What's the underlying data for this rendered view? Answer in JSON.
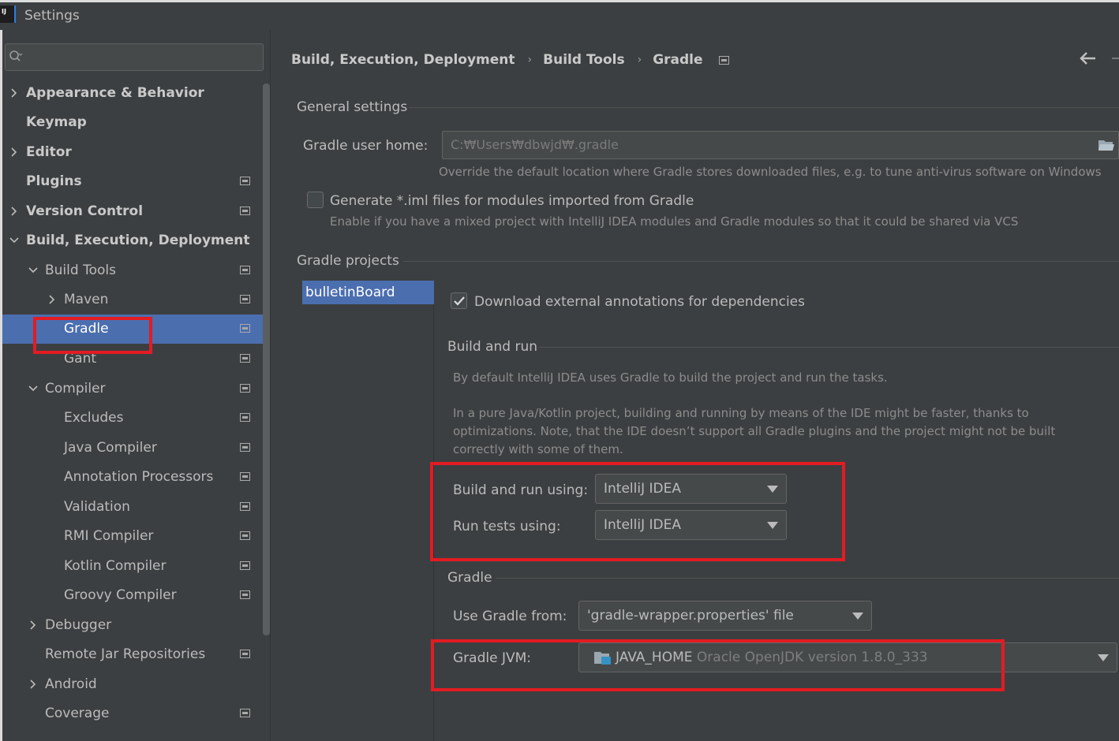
{
  "window": {
    "title": "Settings",
    "logo_text": "IJ"
  },
  "search": {
    "placeholder": "",
    "value": ""
  },
  "sidebar": {
    "items": [
      {
        "label": "Appearance & Behavior",
        "bold": true,
        "chevron": "right"
      },
      {
        "label": "Keymap",
        "bold": true
      },
      {
        "label": "Editor",
        "bold": true,
        "chevron": "right"
      },
      {
        "label": "Plugins",
        "bold": true,
        "project_icon": true
      },
      {
        "label": "Version Control",
        "bold": true,
        "chevron": "right",
        "project_icon": true
      },
      {
        "label": "Build, Execution, Deployment",
        "bold": true,
        "chevron": "down"
      },
      {
        "label": "Build Tools",
        "chevron": "down",
        "project_icon": true
      },
      {
        "label": "Maven",
        "chevron": "right",
        "project_icon": true
      },
      {
        "label": "Gradle",
        "selected": true,
        "project_icon": true
      },
      {
        "label": "Gant",
        "project_icon": true
      },
      {
        "label": "Compiler",
        "chevron": "down",
        "project_icon": true
      },
      {
        "label": "Excludes",
        "project_icon": true
      },
      {
        "label": "Java Compiler",
        "project_icon": true
      },
      {
        "label": "Annotation Processors",
        "project_icon": true
      },
      {
        "label": "Validation",
        "project_icon": true
      },
      {
        "label": "RMI Compiler",
        "project_icon": true
      },
      {
        "label": "Kotlin Compiler",
        "project_icon": true
      },
      {
        "label": "Groovy Compiler",
        "project_icon": true
      },
      {
        "label": "Debugger",
        "chevron": "right"
      },
      {
        "label": "Remote Jar Repositories",
        "project_icon": true
      },
      {
        "label": "Android",
        "chevron": "right"
      },
      {
        "label": "Coverage",
        "project_icon": true
      }
    ]
  },
  "breadcrumb": {
    "items": [
      "Build, Execution, Deployment",
      "Build Tools",
      "Gradle"
    ],
    "separator": "›"
  },
  "general": {
    "title": "General settings",
    "user_home_label": "Gradle user home:",
    "user_home_value": "C:₩Users₩dbwjd₩.gradle",
    "user_home_hint": "Override the default location where Gradle stores downloaded files, e.g. to tune anti-virus software on Windows",
    "iml_label": "Generate *.iml files for modules imported from Gradle",
    "iml_hint": "Enable if you have a mixed project with IntelliJ IDEA modules and Gradle modules so that it could be shared via VCS",
    "iml_checked": false
  },
  "projects": {
    "title": "Gradle projects",
    "list": [
      "bulletinBoard"
    ],
    "download_annotations_label": "Download external annotations for dependencies",
    "download_annotations_checked": true
  },
  "build_and_run": {
    "title": "Build and run",
    "para1": "By default IntelliJ IDEA uses Gradle to build the project and run the tasks.",
    "para2": "In a pure Java/Kotlin project, building and running by means of the IDE might be faster, thanks to optimizations. Note, that the IDE doesn’t support all Gradle plugins and the project might not be built correctly with some of them.",
    "build_run_label": "Build and run using:",
    "build_run_value": "IntelliJ IDEA",
    "run_tests_label": "Run tests using:",
    "run_tests_value": "IntelliJ IDEA"
  },
  "gradle": {
    "title": "Gradle",
    "use_from_label": "Use Gradle from:",
    "use_from_value": "'gradle-wrapper.properties' file",
    "jvm_label": "Gradle JVM:",
    "jvm_name": "JAVA_HOME",
    "jvm_detail": "Oracle OpenJDK version 1.8.0_333"
  },
  "colors": {
    "background": "#3c3f41",
    "selection": "#4b6eaf",
    "highlight_box": "#e31b23"
  }
}
